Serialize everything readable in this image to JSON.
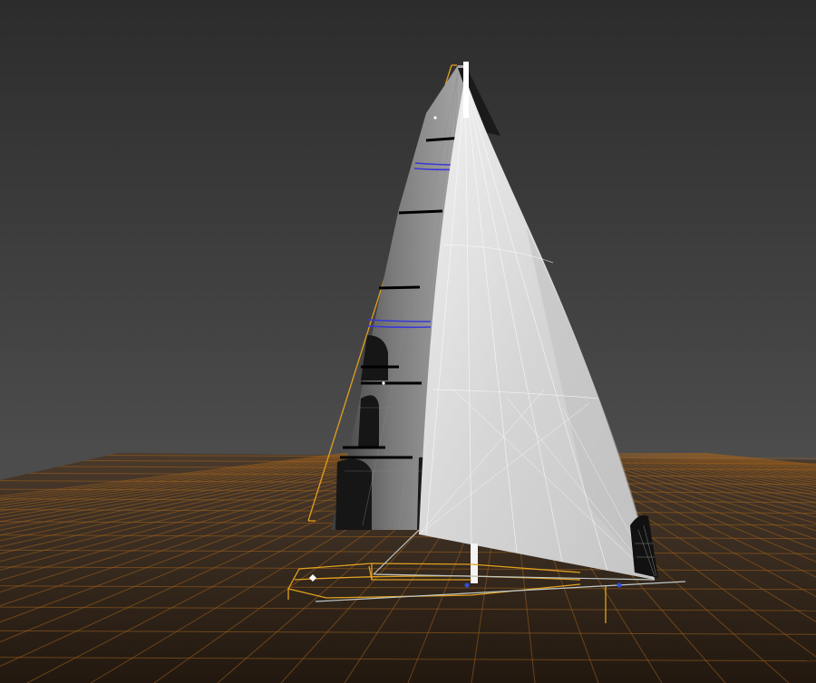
{
  "scene": {
    "kind": "3d-sail-design-viewport",
    "background_top_color": "#2e2e2e",
    "background_horizon_color": "#4a4a4a",
    "floor_color": "#3a2b1f",
    "grid_color": "#b06a1c",
    "rig_line_color": "#e0a020",
    "batten_color": "#000000",
    "stripe_color": "#3a3ad0",
    "mainsail_color": "#6e6e6e",
    "jib_color": "#d8d8d8",
    "mast_color": "#ffffff"
  }
}
